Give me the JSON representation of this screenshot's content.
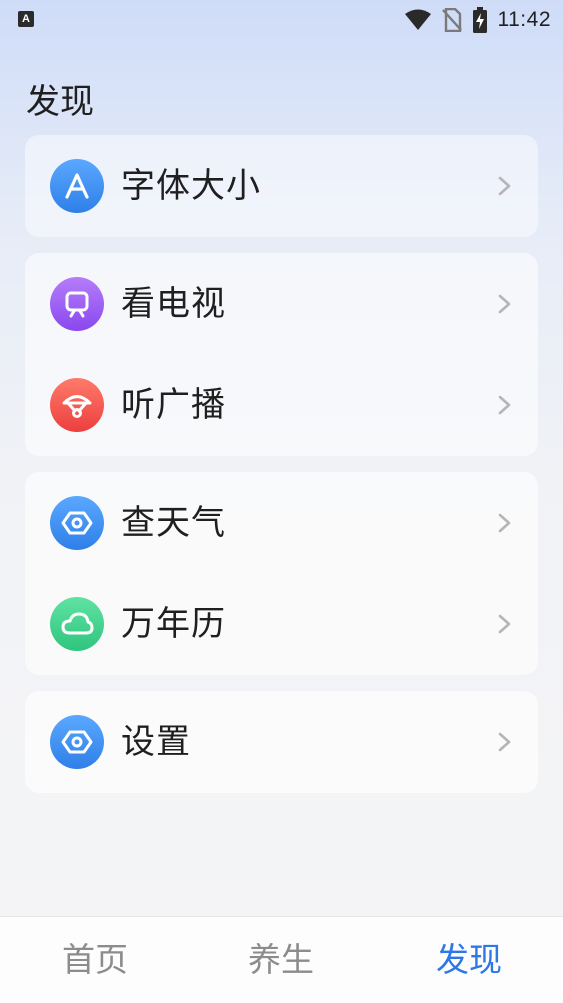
{
  "status_bar": {
    "time": "11:42",
    "left_icon_letter": "A",
    "icons": [
      "wifi-icon",
      "no-sim-icon",
      "battery-charging-icon"
    ]
  },
  "page": {
    "title": "发现"
  },
  "menu": {
    "font_size": {
      "label": "字体大小",
      "icon": "font-icon",
      "color": "#3d8ff0"
    },
    "watch_tv": {
      "label": "看电视",
      "icon": "tv-icon",
      "color": "#9b5cf2"
    },
    "radio": {
      "label": "听广播",
      "icon": "radio-icon",
      "color": "#f0574d"
    },
    "weather": {
      "label": "查天气",
      "icon": "hexagon-icon",
      "color": "#3d8ff0"
    },
    "calendar": {
      "label": "万年历",
      "icon": "cloud-icon",
      "color": "#3dcf8a"
    },
    "settings": {
      "label": "设置",
      "icon": "hexagon-icon",
      "color": "#3d8ff0"
    }
  },
  "bottom_nav": {
    "tabs": [
      {
        "label": "首页",
        "active": false
      },
      {
        "label": "养生",
        "active": false
      },
      {
        "label": "发现",
        "active": true
      }
    ],
    "active_color": "#2d78e6",
    "inactive_color": "#8c8c8c"
  }
}
